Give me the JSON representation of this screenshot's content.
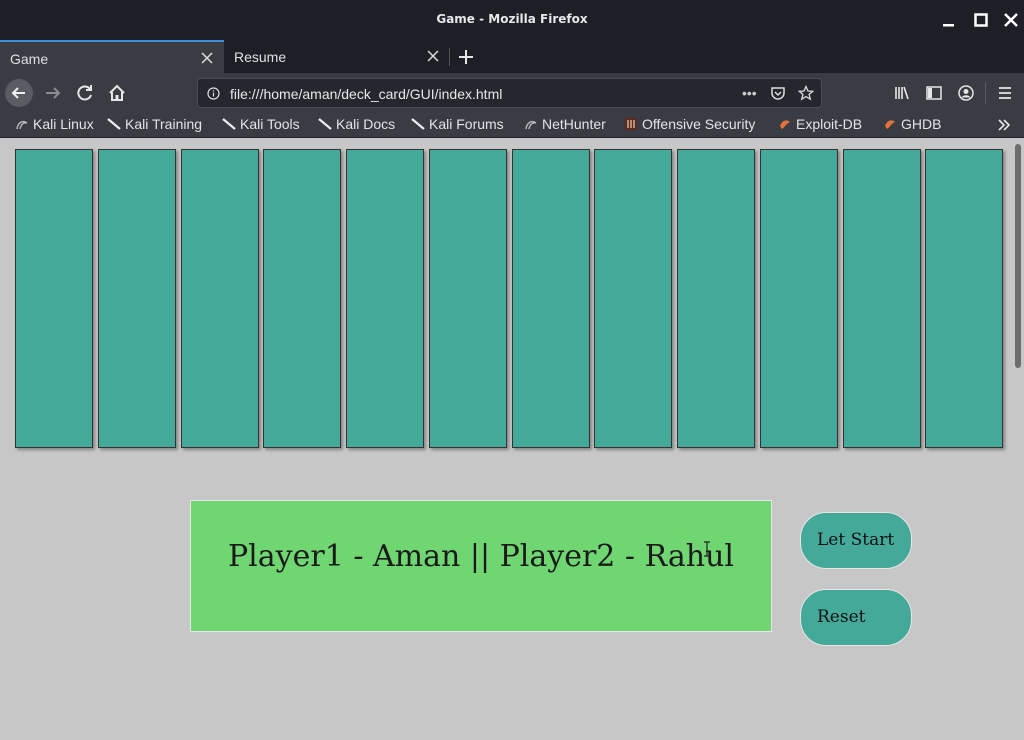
{
  "window": {
    "title": "Game - Mozilla Firefox"
  },
  "tabs": [
    {
      "label": "Game",
      "active": true
    },
    {
      "label": "Resume",
      "active": false
    }
  ],
  "address_bar": {
    "url": "file:///home/aman/deck_card/GUI/index.html"
  },
  "bookmarks": [
    {
      "label": "Kali Linux",
      "icon": "kali-dragon-icon"
    },
    {
      "label": "Kali Training",
      "icon": "kali-tool-icon"
    },
    {
      "label": "Kali Tools",
      "icon": "kali-tool-icon"
    },
    {
      "label": "Kali Docs",
      "icon": "kali-tool-icon"
    },
    {
      "label": "Kali Forums",
      "icon": "kali-tool-icon"
    },
    {
      "label": "NetHunter",
      "icon": "kali-dragon-icon"
    },
    {
      "label": "Offensive Security",
      "icon": "offsec-icon"
    },
    {
      "label": "Exploit-DB",
      "icon": "exploitdb-icon"
    },
    {
      "label": "GHDB",
      "icon": "exploitdb-icon"
    }
  ],
  "game": {
    "card_count": 12,
    "card_color": "#45a99a",
    "players_text": "Player1 - Aman || Player2 - Rahul",
    "panel_color": "#6fd672",
    "buttons": {
      "start_label": "Let Start",
      "reset_label": "Reset"
    }
  }
}
